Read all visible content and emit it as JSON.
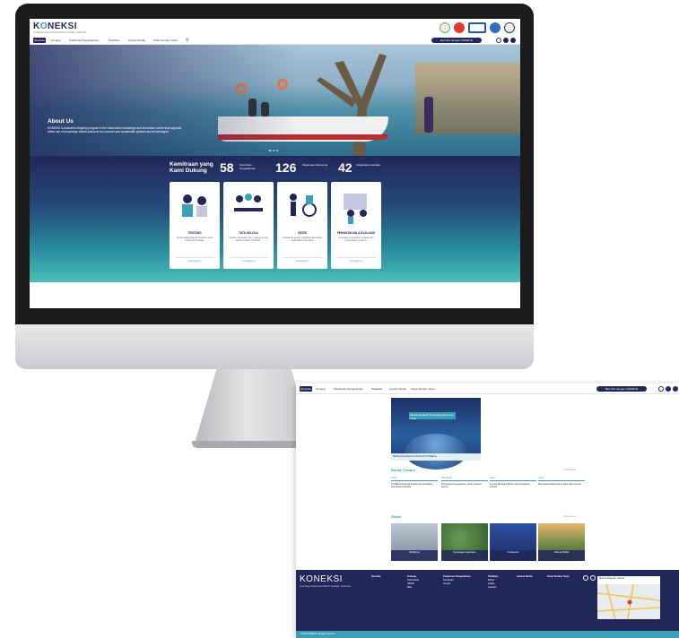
{
  "brand": {
    "name": "KONEKSI",
    "tagline": "Knowledge Partnership Platform Australia - Indonesia"
  },
  "nav": {
    "items": [
      "Beranda",
      "Tentang",
      "Kolaborasi Pengetahuan",
      "Publikasi",
      "Liputan Media",
      "Pusat Sumber Daya"
    ],
    "cta": "Bermitra dengan KONEKSI"
  },
  "hero": {
    "title": "About Us",
    "text": "KONEKSI is Australia's flagship program in the Indonesian knowledge and innovation sector that supports better use of knowledge-based solutions for inclusive and sustainable policies and technologies."
  },
  "stats": {
    "heading": "Kemitraan yang Kami Dukung",
    "items": [
      {
        "value": "58",
        "label": "Kemitraan Pengetahuan"
      },
      {
        "value": "126",
        "label": "Organisasi Indonesia"
      },
      {
        "value": "42",
        "label": "Organisasi Australia"
      }
    ]
  },
  "cards": [
    {
      "title": "TENTANG",
      "desc": "Simak bagaimana kami bekerja untuk inovasi di Indonesia.",
      "link": "Selengkapnya"
    },
    {
      "title": "TATA KELOLA",
      "desc": "Struktur, kemitraan, dan mekanisme tata kelola program KONEKSI.",
      "link": "Selengkapnya"
    },
    {
      "title": "GEDSI",
      "desc": "Kesetaraan gender, disabilitas dan inklusi sosial dalam kerja kami.",
      "link": "Selengkapnya"
    },
    {
      "title": "PEMANTAUAN & EVALUASI",
      "desc": "Kerangka pemantauan, evaluasi dan pembelajaran program.",
      "link": "Selengkapnya"
    }
  ],
  "page2": {
    "nav_cta": "Bermitra dengan KONEKSI",
    "featured_label": "Global Research Technology Economy Trade",
    "featured_caption": "Making Development Work with KONEKSI",
    "news_title": "Berita Terbaru",
    "news_see_all": "Lihat Semua",
    "news": [
      {
        "tag": "Artikel",
        "text": "KONEKSI Perkuat Kolaborasi Penelitian Indonesia-Australia"
      },
      {
        "tag": "Rilis Media",
        "text": "Kemitraan Pengetahuan untuk Transisi Energi"
      },
      {
        "tag": "Artikel",
        "text": "Inovasi Berbasis Riset untuk Kebijakan Inklusif"
      },
      {
        "tag": "Artikel",
        "text": "Memperkuat Ekosistem Riset dan Inovasi"
      }
    ],
    "gallery_title": "Galeri",
    "gallery_see_all": "Lihat Semua",
    "gallery": [
      {
        "label": "Workshop"
      },
      {
        "label": "Kunjungan Lapangan"
      },
      {
        "label": "Konferensi"
      },
      {
        "label": "Diskusi Publik"
      }
    ],
    "footer": {
      "logo": "KONEKSI",
      "tagline": "Knowledge Partnership Platform Australia - Indonesia",
      "cols": [
        {
          "head": "Beranda",
          "items": []
        },
        {
          "head": "Tentang",
          "items": [
            "Tata Kelola",
            "GEDSI",
            "MEL"
          ]
        },
        {
          "head": "Kolaborasi Pengetahuan",
          "items": [
            "Kemitraan",
            "Proyek"
          ]
        },
        {
          "head": "Publikasi",
          "items": [
            "Berita",
            "Artikel",
            "Laporan"
          ]
        },
        {
          "head": "Liputan Media",
          "items": []
        },
        {
          "head": "Pusat Sumber Daya",
          "items": []
        }
      ],
      "map_title": "Menara Rajawali, Jakarta",
      "copyright": "© 2024 KONEKSI. All rights reserved."
    }
  },
  "colors": {
    "navy": "#22275a",
    "teal": "#3a9fb7"
  }
}
